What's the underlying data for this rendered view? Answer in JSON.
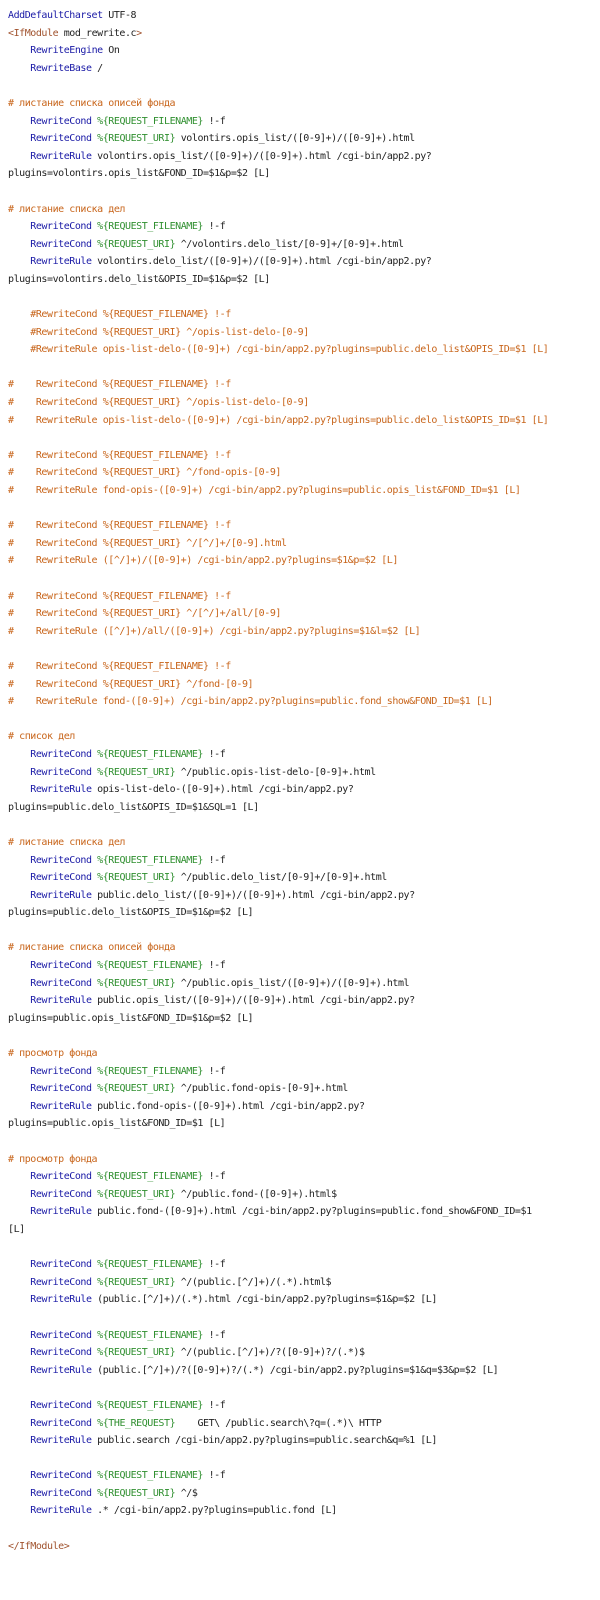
{
  "lines": [
    [
      {
        "t": "kw",
        "s": "AddDefaultCharset"
      },
      {
        "t": "text",
        "s": " UTF-8"
      }
    ],
    [
      {
        "t": "tag",
        "s": "<IfModule"
      },
      {
        "t": "text",
        "s": " mod_rewrite.c"
      },
      {
        "t": "tag",
        "s": ">"
      }
    ],
    [
      {
        "t": "text",
        "s": "    "
      },
      {
        "t": "kw",
        "s": "RewriteEngine"
      },
      {
        "t": "text",
        "s": " On"
      }
    ],
    [
      {
        "t": "text",
        "s": "    "
      },
      {
        "t": "kw",
        "s": "RewriteBase"
      },
      {
        "t": "text",
        "s": " /"
      }
    ],
    [],
    [
      {
        "t": "comment",
        "s": "# листание списка описей фонда"
      }
    ],
    [
      {
        "t": "text",
        "s": "    "
      },
      {
        "t": "kw",
        "s": "RewriteCond"
      },
      {
        "t": "text",
        "s": " "
      },
      {
        "t": "var",
        "s": "%{REQUEST_FILENAME}"
      },
      {
        "t": "text",
        "s": " !-f"
      }
    ],
    [
      {
        "t": "text",
        "s": "    "
      },
      {
        "t": "kw",
        "s": "RewriteCond"
      },
      {
        "t": "text",
        "s": " "
      },
      {
        "t": "var",
        "s": "%{REQUEST_URI}"
      },
      {
        "t": "text",
        "s": " volontirs.opis_list/([0-9]+)/([0-9]+).html"
      }
    ],
    [
      {
        "t": "text",
        "s": "    "
      },
      {
        "t": "kw",
        "s": "RewriteRule"
      },
      {
        "t": "text",
        "s": " volontirs.opis_list/([0-9]+)/([0-9]+).html /cgi-bin/app2.py?"
      }
    ],
    [
      {
        "t": "text",
        "s": "plugins=volontirs.opis_list&FOND_ID=$1&p=$2 [L]"
      }
    ],
    [],
    [
      {
        "t": "comment",
        "s": "# листание списка дел"
      }
    ],
    [
      {
        "t": "text",
        "s": "    "
      },
      {
        "t": "kw",
        "s": "RewriteCond"
      },
      {
        "t": "text",
        "s": " "
      },
      {
        "t": "var",
        "s": "%{REQUEST_FILENAME}"
      },
      {
        "t": "text",
        "s": " !-f"
      }
    ],
    [
      {
        "t": "text",
        "s": "    "
      },
      {
        "t": "kw",
        "s": "RewriteCond"
      },
      {
        "t": "text",
        "s": " "
      },
      {
        "t": "var",
        "s": "%{REQUEST_URI}"
      },
      {
        "t": "text",
        "s": " ^/volontirs.delo_list/[0-9]+/[0-9]+.html"
      }
    ],
    [
      {
        "t": "text",
        "s": "    "
      },
      {
        "t": "kw",
        "s": "RewriteRule"
      },
      {
        "t": "text",
        "s": " volontirs.delo_list/([0-9]+)/([0-9]+).html /cgi-bin/app2.py?"
      }
    ],
    [
      {
        "t": "text",
        "s": "plugins=volontirs.delo_list&OPIS_ID=$1&p=$2 [L]"
      }
    ],
    [],
    [
      {
        "t": "comment",
        "s": "    #RewriteCond %{REQUEST_FILENAME} !-f"
      }
    ],
    [
      {
        "t": "comment",
        "s": "    #RewriteCond %{REQUEST_URI} ^/opis-list-delo-[0-9]"
      }
    ],
    [
      {
        "t": "comment",
        "s": "    #RewriteRule opis-list-delo-([0-9]+) /cgi-bin/app2.py?plugins=public.delo_list&OPIS_ID=$1 [L]"
      }
    ],
    [],
    [
      {
        "t": "comment",
        "s": "#    RewriteCond %{REQUEST_FILENAME} !-f"
      }
    ],
    [
      {
        "t": "comment",
        "s": "#    RewriteCond %{REQUEST_URI} ^/opis-list-delo-[0-9]"
      }
    ],
    [
      {
        "t": "comment",
        "s": "#    RewriteRule opis-list-delo-([0-9]+) /cgi-bin/app2.py?plugins=public.delo_list&OPIS_ID=$1 [L]"
      }
    ],
    [],
    [
      {
        "t": "comment",
        "s": "#    RewriteCond %{REQUEST_FILENAME} !-f"
      }
    ],
    [
      {
        "t": "comment",
        "s": "#    RewriteCond %{REQUEST_URI} ^/fond-opis-[0-9]"
      }
    ],
    [
      {
        "t": "comment",
        "s": "#    RewriteRule fond-opis-([0-9]+) /cgi-bin/app2.py?plugins=public.opis_list&FOND_ID=$1 [L]"
      }
    ],
    [],
    [
      {
        "t": "comment",
        "s": "#    RewriteCond %{REQUEST_FILENAME} !-f"
      }
    ],
    [
      {
        "t": "comment",
        "s": "#    RewriteCond %{REQUEST_URI} ^/[^/]+/[0-9].html"
      }
    ],
    [
      {
        "t": "comment",
        "s": "#    RewriteRule ([^/]+)/([0-9]+) /cgi-bin/app2.py?plugins=$1&p=$2 [L]"
      }
    ],
    [],
    [
      {
        "t": "comment",
        "s": "#    RewriteCond %{REQUEST_FILENAME} !-f"
      }
    ],
    [
      {
        "t": "comment",
        "s": "#    RewriteCond %{REQUEST_URI} ^/[^/]+/all/[0-9]"
      }
    ],
    [
      {
        "t": "comment",
        "s": "#    RewriteRule ([^/]+)/all/([0-9]+) /cgi-bin/app2.py?plugins=$1&l=$2 [L]"
      }
    ],
    [],
    [
      {
        "t": "comment",
        "s": "#    RewriteCond %{REQUEST_FILENAME} !-f"
      }
    ],
    [
      {
        "t": "comment",
        "s": "#    RewriteCond %{REQUEST_URI} ^/fond-[0-9]"
      }
    ],
    [
      {
        "t": "comment",
        "s": "#    RewriteRule fond-([0-9]+) /cgi-bin/app2.py?plugins=public.fond_show&FOND_ID=$1 [L]"
      }
    ],
    [],
    [
      {
        "t": "comment",
        "s": "# список дел"
      }
    ],
    [
      {
        "t": "text",
        "s": "    "
      },
      {
        "t": "kw",
        "s": "RewriteCond"
      },
      {
        "t": "text",
        "s": " "
      },
      {
        "t": "var",
        "s": "%{REQUEST_FILENAME}"
      },
      {
        "t": "text",
        "s": " !-f"
      }
    ],
    [
      {
        "t": "text",
        "s": "    "
      },
      {
        "t": "kw",
        "s": "RewriteCond"
      },
      {
        "t": "text",
        "s": " "
      },
      {
        "t": "var",
        "s": "%{REQUEST_URI}"
      },
      {
        "t": "text",
        "s": " ^/public.opis-list-delo-[0-9]+.html"
      }
    ],
    [
      {
        "t": "text",
        "s": "    "
      },
      {
        "t": "kw",
        "s": "RewriteRule"
      },
      {
        "t": "text",
        "s": " opis-list-delo-([0-9]+).html /cgi-bin/app2.py?"
      }
    ],
    [
      {
        "t": "text",
        "s": "plugins=public.delo_list&OPIS_ID=$1&SQL=1 [L]"
      }
    ],
    [],
    [
      {
        "t": "comment",
        "s": "# листание списка дел"
      }
    ],
    [
      {
        "t": "text",
        "s": "    "
      },
      {
        "t": "kw",
        "s": "RewriteCond"
      },
      {
        "t": "text",
        "s": " "
      },
      {
        "t": "var",
        "s": "%{REQUEST_FILENAME}"
      },
      {
        "t": "text",
        "s": " !-f"
      }
    ],
    [
      {
        "t": "text",
        "s": "    "
      },
      {
        "t": "kw",
        "s": "RewriteCond"
      },
      {
        "t": "text",
        "s": " "
      },
      {
        "t": "var",
        "s": "%{REQUEST_URI}"
      },
      {
        "t": "text",
        "s": " ^/public.delo_list/[0-9]+/[0-9]+.html"
      }
    ],
    [
      {
        "t": "text",
        "s": "    "
      },
      {
        "t": "kw",
        "s": "RewriteRule"
      },
      {
        "t": "text",
        "s": " public.delo_list/([0-9]+)/([0-9]+).html /cgi-bin/app2.py?"
      }
    ],
    [
      {
        "t": "text",
        "s": "plugins=public.delo_list&OPIS_ID=$1&p=$2 [L]"
      }
    ],
    [],
    [
      {
        "t": "comment",
        "s": "# листание списка описей фонда"
      }
    ],
    [
      {
        "t": "text",
        "s": "    "
      },
      {
        "t": "kw",
        "s": "RewriteCond"
      },
      {
        "t": "text",
        "s": " "
      },
      {
        "t": "var",
        "s": "%{REQUEST_FILENAME}"
      },
      {
        "t": "text",
        "s": " !-f"
      }
    ],
    [
      {
        "t": "text",
        "s": "    "
      },
      {
        "t": "kw",
        "s": "RewriteCond"
      },
      {
        "t": "text",
        "s": " "
      },
      {
        "t": "var",
        "s": "%{REQUEST_URI}"
      },
      {
        "t": "text",
        "s": " ^/public.opis_list/([0-9]+)/([0-9]+).html"
      }
    ],
    [
      {
        "t": "text",
        "s": "    "
      },
      {
        "t": "kw",
        "s": "RewriteRule"
      },
      {
        "t": "text",
        "s": " public.opis_list/([0-9]+)/([0-9]+).html /cgi-bin/app2.py?"
      }
    ],
    [
      {
        "t": "text",
        "s": "plugins=public.opis_list&FOND_ID=$1&p=$2 [L]"
      }
    ],
    [],
    [
      {
        "t": "comment",
        "s": "# просмотр фонда"
      }
    ],
    [
      {
        "t": "text",
        "s": "    "
      },
      {
        "t": "kw",
        "s": "RewriteCond"
      },
      {
        "t": "text",
        "s": " "
      },
      {
        "t": "var",
        "s": "%{REQUEST_FILENAME}"
      },
      {
        "t": "text",
        "s": " !-f"
      }
    ],
    [
      {
        "t": "text",
        "s": "    "
      },
      {
        "t": "kw",
        "s": "RewriteCond"
      },
      {
        "t": "text",
        "s": " "
      },
      {
        "t": "var",
        "s": "%{REQUEST_URI}"
      },
      {
        "t": "text",
        "s": " ^/public.fond-opis-[0-9]+.html"
      }
    ],
    [
      {
        "t": "text",
        "s": "    "
      },
      {
        "t": "kw",
        "s": "RewriteRule"
      },
      {
        "t": "text",
        "s": " public.fond-opis-([0-9]+).html /cgi-bin/app2.py?"
      }
    ],
    [
      {
        "t": "text",
        "s": "plugins=public.opis_list&FOND_ID=$1 [L]"
      }
    ],
    [],
    [
      {
        "t": "comment",
        "s": "# просмотр фонда"
      }
    ],
    [
      {
        "t": "text",
        "s": "    "
      },
      {
        "t": "kw",
        "s": "RewriteCond"
      },
      {
        "t": "text",
        "s": " "
      },
      {
        "t": "var",
        "s": "%{REQUEST_FILENAME}"
      },
      {
        "t": "text",
        "s": " !-f"
      }
    ],
    [
      {
        "t": "text",
        "s": "    "
      },
      {
        "t": "kw",
        "s": "RewriteCond"
      },
      {
        "t": "text",
        "s": " "
      },
      {
        "t": "var",
        "s": "%{REQUEST_URI}"
      },
      {
        "t": "text",
        "s": " ^/public.fond-([0-9]+).html$"
      }
    ],
    [
      {
        "t": "text",
        "s": "    "
      },
      {
        "t": "kw",
        "s": "RewriteRule"
      },
      {
        "t": "text",
        "s": " public.fond-([0-9]+).html /cgi-bin/app2.py?plugins=public.fond_show&FOND_ID=$1"
      }
    ],
    [
      {
        "t": "text",
        "s": "[L]"
      }
    ],
    [],
    [
      {
        "t": "text",
        "s": "    "
      },
      {
        "t": "kw",
        "s": "RewriteCond"
      },
      {
        "t": "text",
        "s": " "
      },
      {
        "t": "var",
        "s": "%{REQUEST_FILENAME}"
      },
      {
        "t": "text",
        "s": " !-f"
      }
    ],
    [
      {
        "t": "text",
        "s": "    "
      },
      {
        "t": "kw",
        "s": "RewriteCond"
      },
      {
        "t": "text",
        "s": " "
      },
      {
        "t": "var",
        "s": "%{REQUEST_URI}"
      },
      {
        "t": "text",
        "s": " ^/(public.[^/]+)/(.*).html$"
      }
    ],
    [
      {
        "t": "text",
        "s": "    "
      },
      {
        "t": "kw",
        "s": "RewriteRule"
      },
      {
        "t": "text",
        "s": " (public.[^/]+)/(.*).html /cgi-bin/app2.py?plugins=$1&p=$2 [L]"
      }
    ],
    [],
    [
      {
        "t": "text",
        "s": "    "
      },
      {
        "t": "kw",
        "s": "RewriteCond"
      },
      {
        "t": "text",
        "s": " "
      },
      {
        "t": "var",
        "s": "%{REQUEST_FILENAME}"
      },
      {
        "t": "text",
        "s": " !-f"
      }
    ],
    [
      {
        "t": "text",
        "s": "    "
      },
      {
        "t": "kw",
        "s": "RewriteCond"
      },
      {
        "t": "text",
        "s": " "
      },
      {
        "t": "var",
        "s": "%{REQUEST_URI}"
      },
      {
        "t": "text",
        "s": " ^/(public.[^/]+)/?([0-9]+)?/(.*)$"
      }
    ],
    [
      {
        "t": "text",
        "s": "    "
      },
      {
        "t": "kw",
        "s": "RewriteRule"
      },
      {
        "t": "text",
        "s": " (public.[^/]+)/?([0-9]+)?/(.*) /cgi-bin/app2.py?plugins=$1&q=$3&p=$2 [L]"
      }
    ],
    [],
    [
      {
        "t": "text",
        "s": "    "
      },
      {
        "t": "kw",
        "s": "RewriteCond"
      },
      {
        "t": "text",
        "s": " "
      },
      {
        "t": "var",
        "s": "%{REQUEST_FILENAME}"
      },
      {
        "t": "text",
        "s": " !-f"
      }
    ],
    [
      {
        "t": "text",
        "s": "    "
      },
      {
        "t": "kw",
        "s": "RewriteCond"
      },
      {
        "t": "text",
        "s": " "
      },
      {
        "t": "var",
        "s": "%{THE_REQUEST}"
      },
      {
        "t": "text",
        "s": "    GET\\ /public.search\\?q=(.*)\\ HTTP"
      }
    ],
    [
      {
        "t": "text",
        "s": "    "
      },
      {
        "t": "kw",
        "s": "RewriteRule"
      },
      {
        "t": "text",
        "s": " public.search /cgi-bin/app2.py?plugins=public.search&q=%1 [L]"
      }
    ],
    [],
    [
      {
        "t": "text",
        "s": "    "
      },
      {
        "t": "kw",
        "s": "RewriteCond"
      },
      {
        "t": "text",
        "s": " "
      },
      {
        "t": "var",
        "s": "%{REQUEST_FILENAME}"
      },
      {
        "t": "text",
        "s": " !-f"
      }
    ],
    [
      {
        "t": "text",
        "s": "    "
      },
      {
        "t": "kw",
        "s": "RewriteCond"
      },
      {
        "t": "text",
        "s": " "
      },
      {
        "t": "var",
        "s": "%{REQUEST_URI}"
      },
      {
        "t": "text",
        "s": " ^/$"
      }
    ],
    [
      {
        "t": "text",
        "s": "    "
      },
      {
        "t": "kw",
        "s": "RewriteRule"
      },
      {
        "t": "text",
        "s": " .* /cgi-bin/app2.py?plugins=public.fond [L]"
      }
    ],
    [],
    [
      {
        "t": "tag",
        "s": "</IfModule>"
      }
    ]
  ],
  "colors": {
    "keyword": "#1a1aa6",
    "variable": "#2f8f2f",
    "tag": "#a0522d",
    "comment": "#c8651b",
    "text": "#222222",
    "background": "#ffffff"
  }
}
